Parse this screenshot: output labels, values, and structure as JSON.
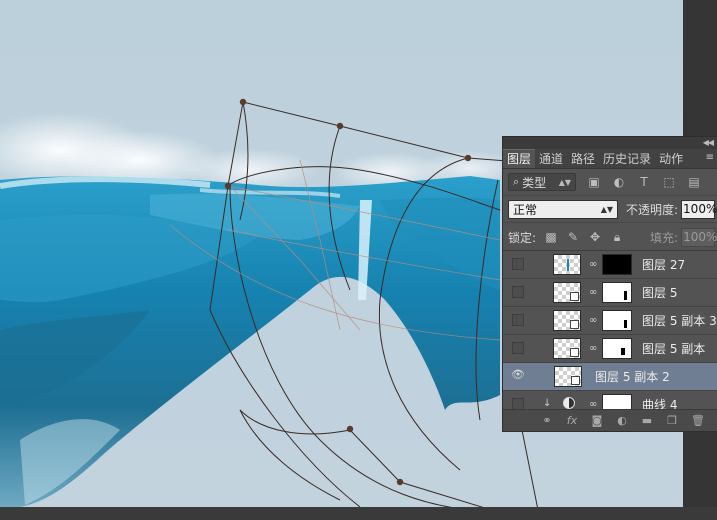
{
  "layers_panel": {
    "tabs": [
      {
        "label": "图层",
        "active": true
      },
      {
        "label": "通道",
        "active": false
      },
      {
        "label": "路径",
        "active": false
      },
      {
        "label": "历史记录",
        "active": false
      },
      {
        "label": "动作",
        "active": false
      }
    ],
    "filter": {
      "label": "类型",
      "icons": [
        "image-filter-icon",
        "adjustment-filter-icon",
        "type-filter-icon",
        "shape-filter-icon",
        "smart-object-filter-icon"
      ]
    },
    "blend_mode": "正常",
    "opacity_label": "不透明度:",
    "opacity_value": "100%",
    "lock_label": "锁定:",
    "fill_label": "填充:",
    "fill_value": "100%",
    "layers": [
      {
        "name": "图层 27",
        "visible": false,
        "selected": false
      },
      {
        "name": "图层 5",
        "visible": false,
        "selected": false
      },
      {
        "name": "图层 5 副本 3",
        "visible": false,
        "selected": false
      },
      {
        "name": "图层 5 副本",
        "visible": false,
        "selected": false
      },
      {
        "name": "图层 5 副本 2",
        "visible": true,
        "selected": true
      },
      {
        "name": "曲线 4",
        "visible": false,
        "selected": false
      }
    ],
    "footer_icons": [
      "link-layers-icon",
      "fx-icon",
      "add-mask-icon",
      "adjustment-layer-icon",
      "group-folder-icon",
      "new-layer-icon",
      "trash-icon"
    ]
  },
  "colors": {
    "canvas_bg": "#bfd1dd",
    "panel_bg": "#535353",
    "selected_layer": "#6f7e92",
    "water_dark": "#1a6f93",
    "water_light": "#3aa6cf"
  }
}
